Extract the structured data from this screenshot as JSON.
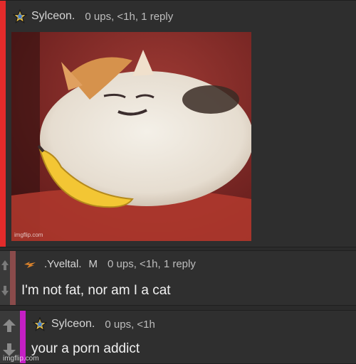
{
  "comments": [
    {
      "username": "Sylceon.",
      "meta": "0 ups, <1h, 1 reply",
      "accent_color": "#e32b2b",
      "icon": "rainbow-star-icon",
      "image": {
        "description_icon": "fat-cat-banana-painting",
        "watermark": "imgflip.com"
      }
    },
    {
      "username": ".Yveltal.",
      "badge": "M",
      "meta": "0 ups, <1h, 1 reply",
      "accent_color": "#8a4b4b",
      "icon": "yveltal-logo-icon",
      "text": "I'm not fat, nor am I a cat"
    },
    {
      "username": "Sylceon.",
      "meta": "0 ups, <1h",
      "accent_color": "#c51fc5",
      "icon": "rainbow-star-icon",
      "text": "your a porn addict"
    }
  ],
  "footer_watermark": "imgflip.com"
}
